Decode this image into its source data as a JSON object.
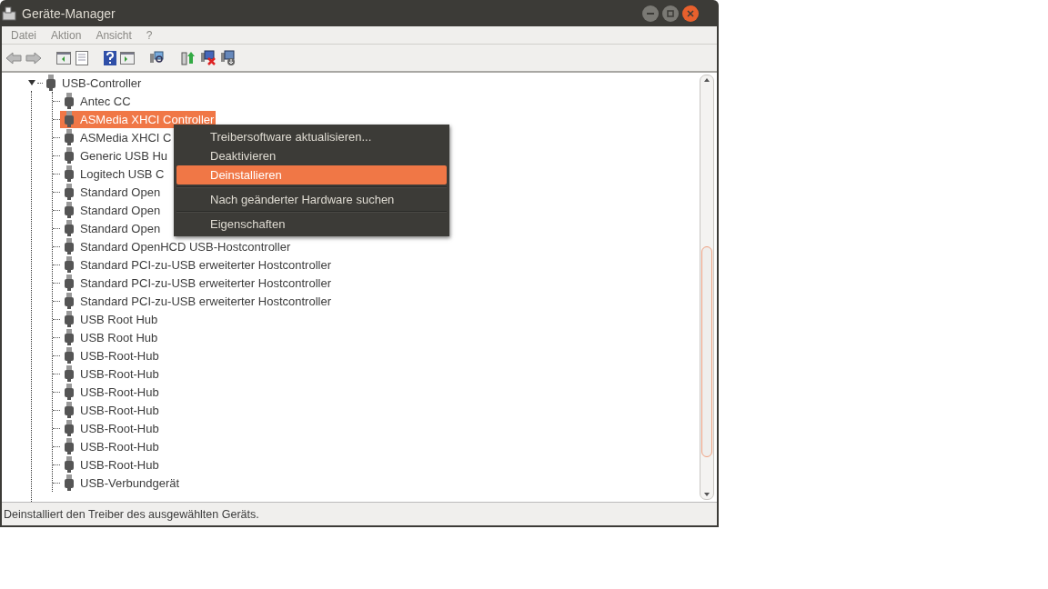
{
  "window": {
    "title": "Geräte-Manager"
  },
  "menu_bar": [
    "Datei",
    "Aktion",
    "Ansicht",
    "?"
  ],
  "tree": {
    "label": "USB-Controller",
    "expanded": true,
    "children": [
      {
        "label": "Antec CC",
        "selected": false
      },
      {
        "label": "ASMedia XHCI Controller",
        "selected": true
      },
      {
        "label": "ASMedia XHCI C",
        "selected": false
      },
      {
        "label": "Generic USB Hu",
        "selected": false
      },
      {
        "label": "Logitech USB C",
        "selected": false
      },
      {
        "label": "Standard Open",
        "selected": false
      },
      {
        "label": "Standard Open",
        "selected": false
      },
      {
        "label": "Standard Open",
        "selected": false
      },
      {
        "label": "Standard OpenHCD USB-Hostcontroller",
        "selected": false
      },
      {
        "label": "Standard PCI-zu-USB erweiterter Hostcontroller",
        "selected": false
      },
      {
        "label": "Standard PCI-zu-USB erweiterter Hostcontroller",
        "selected": false
      },
      {
        "label": "Standard PCI-zu-USB erweiterter Hostcontroller",
        "selected": false
      },
      {
        "label": "USB Root Hub",
        "selected": false
      },
      {
        "label": "USB Root Hub",
        "selected": false
      },
      {
        "label": "USB-Root-Hub",
        "selected": false
      },
      {
        "label": "USB-Root-Hub",
        "selected": false
      },
      {
        "label": "USB-Root-Hub",
        "selected": false
      },
      {
        "label": "USB-Root-Hub",
        "selected": false
      },
      {
        "label": "USB-Root-Hub",
        "selected": false
      },
      {
        "label": "USB-Root-Hub",
        "selected": false
      },
      {
        "label": "USB-Root-Hub",
        "selected": false
      },
      {
        "label": "USB-Verbundgerät",
        "selected": false
      }
    ]
  },
  "context_menu": [
    {
      "kind": "item",
      "label": "Treibersoftware aktualisieren...",
      "selected": false
    },
    {
      "kind": "item",
      "label": "Deaktivieren",
      "selected": false
    },
    {
      "kind": "item",
      "label": "Deinstallieren",
      "selected": true
    },
    {
      "kind": "separator"
    },
    {
      "kind": "item",
      "label": "Nach geänderter Hardware suchen",
      "selected": false
    },
    {
      "kind": "separator"
    },
    {
      "kind": "item",
      "label": "Eigenschaften",
      "selected": false
    }
  ],
  "status_bar": "Deinstalliert den Treiber des ausgewählten Geräts."
}
